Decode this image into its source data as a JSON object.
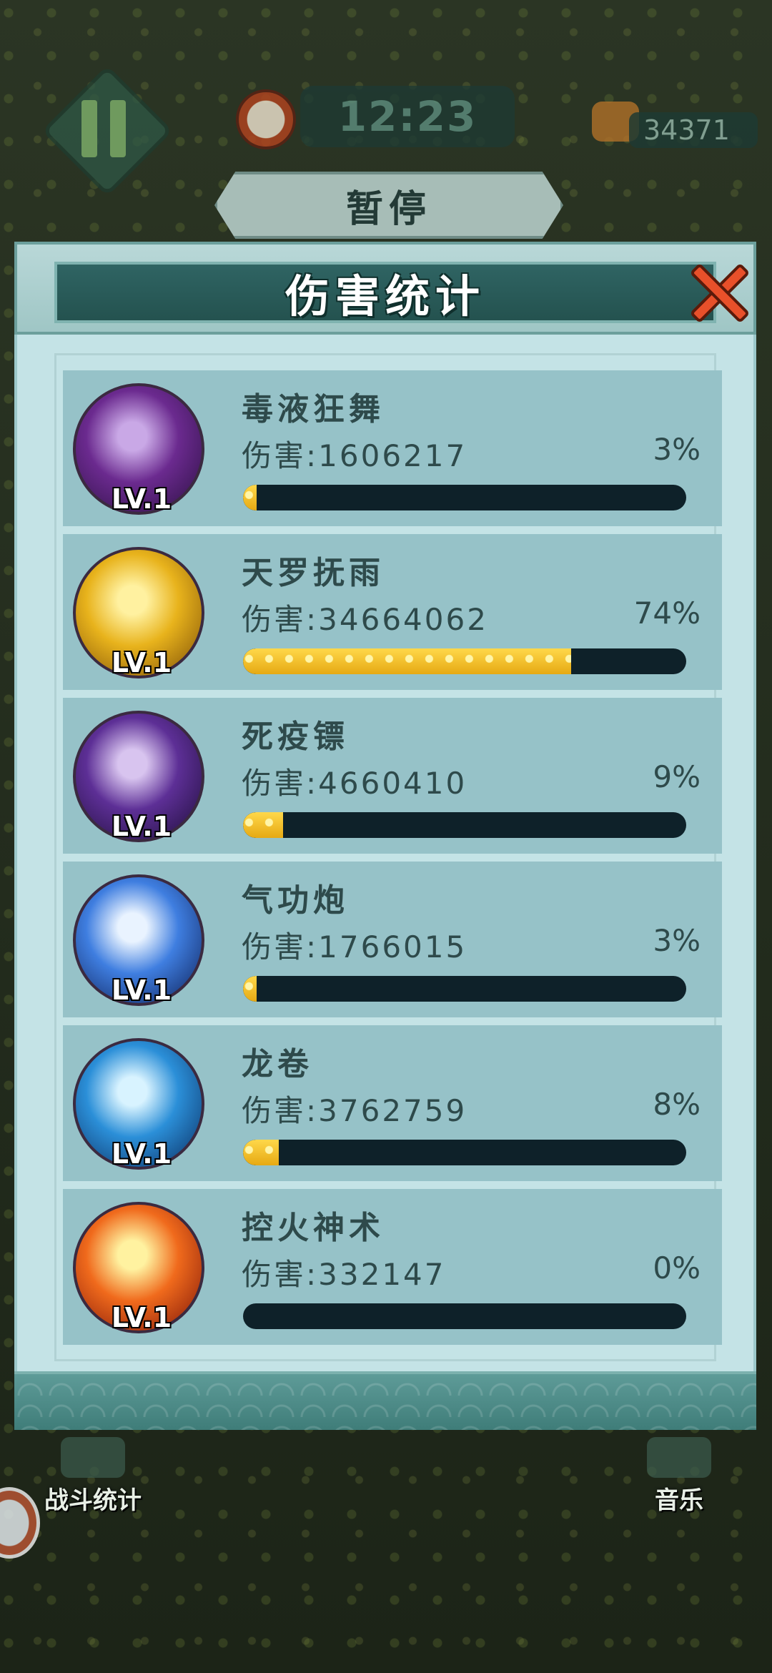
{
  "hud": {
    "timer": "12:23",
    "coins": "34371",
    "pause_label": "暂停"
  },
  "dialog": {
    "title": "伤害统计"
  },
  "skills": [
    {
      "name": "毒液狂舞",
      "damage_label": "伤害:1606217",
      "percent": "3%",
      "fill": 0.03,
      "level": "LV.1",
      "icon": "poison-dance-icon",
      "colors": [
        "#c9a8e6",
        "#6b2a8f",
        "#2a1040"
      ]
    },
    {
      "name": "天罗抚雨",
      "damage_label": "伤害:34664062",
      "percent": "74%",
      "fill": 0.74,
      "level": "LV.1",
      "icon": "golden-fan-icon",
      "colors": [
        "#fff1a0",
        "#e8b31c",
        "#7a4b06"
      ]
    },
    {
      "name": "死疫镖",
      "damage_label": "伤害:4660410",
      "percent": "9%",
      "fill": 0.09,
      "level": "LV.1",
      "icon": "shuriken-icon",
      "colors": [
        "#d8c4ef",
        "#5d2f96",
        "#1d0d36"
      ]
    },
    {
      "name": "气功炮",
      "damage_label": "伤害:1766015",
      "percent": "3%",
      "fill": 0.03,
      "level": "LV.1",
      "icon": "energy-blast-icon",
      "colors": [
        "#e9f3ff",
        "#3f7ee0",
        "#0c1d52"
      ]
    },
    {
      "name": "龙卷",
      "damage_label": "伤害:3762759",
      "percent": "8%",
      "fill": 0.08,
      "level": "LV.1",
      "icon": "tornado-icon",
      "colors": [
        "#d8f3ff",
        "#2b8fd8",
        "#0a2a5c"
      ]
    },
    {
      "name": "控火神术",
      "damage_label": "伤害:332147",
      "percent": "0%",
      "fill": 0.0,
      "level": "LV.1",
      "icon": "fire-icon",
      "colors": [
        "#fff2a0",
        "#f06a1c",
        "#7a1208"
      ]
    }
  ],
  "bottom": {
    "stats_label": "战斗统计",
    "music_label": "音乐"
  }
}
